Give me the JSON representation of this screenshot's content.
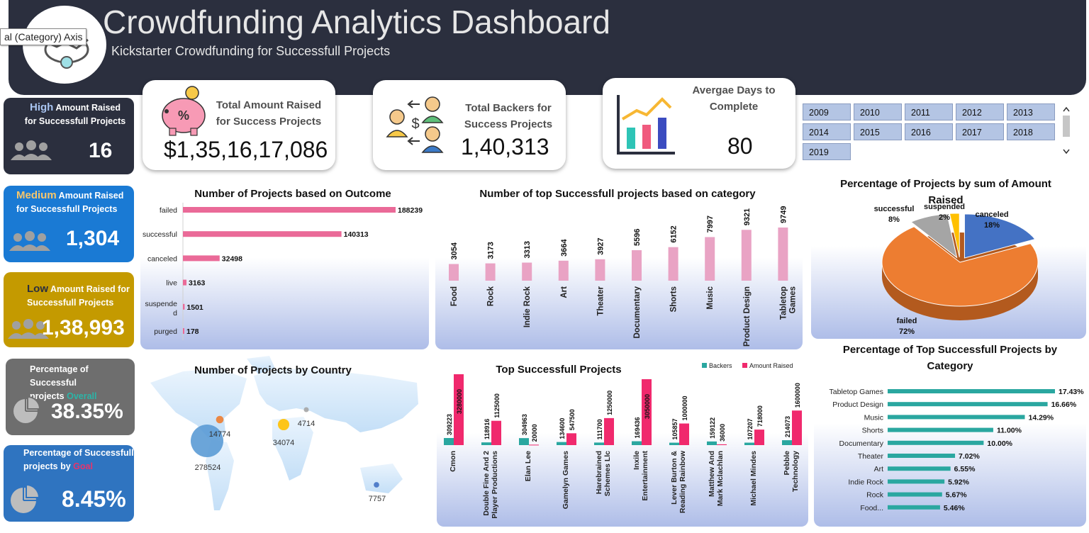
{
  "header": {
    "title": "Crowdfunding Analytics Dashboard",
    "subtitle": "Kickstarter Crowdfunding for Successfull Projects",
    "tooltip": "al (Category) Axis",
    "logo_icon": "handshake-icon"
  },
  "kpis": {
    "amount": {
      "label_line1": "Total Amount Raised",
      "label_line2": "for Success Projects",
      "value": "$1,35,16,17,086",
      "icon": "piggy-bank-icon"
    },
    "backers": {
      "label_line1": "Total Backers for",
      "label_line2": "Success Projects",
      "value": "1,40,313",
      "icon": "people-exchange-icon"
    },
    "days": {
      "label_line1": "Avergae Days to",
      "label_line2": "Complete",
      "value": "80",
      "icon": "bar-chart-icon"
    }
  },
  "years": [
    "2009",
    "2010",
    "2011",
    "2012",
    "2013",
    "2014",
    "2015",
    "2016",
    "2017",
    "2018",
    "2019"
  ],
  "side_cards": [
    {
      "highlight": "High",
      "label_rest": " Amount Raised",
      "label_line2": "for Successfull Projects",
      "value": "16",
      "bg": "#2b2f3e",
      "highlight_color": "#a8c4f0"
    },
    {
      "highlight": "Medium",
      "label_rest": " Amount Raised",
      "label_line2": "for Successfull Projects",
      "value": "1,304",
      "bg": "#1a7ad4",
      "highlight_color": "#f7c66b"
    },
    {
      "highlight": "Low",
      "label_rest": " Amount Raised for",
      "label_line2": "Successfull Projects",
      "value": "1,38,993",
      "bg": "#c49a00",
      "highlight_color": "#2b2f3e"
    },
    {
      "label_line1": "Percentage of Successful",
      "label_line2_prefix": "projects ",
      "highlight": "Overall",
      "value": "38.35%",
      "bg": "#6e6e6e",
      "highlight_color": "#2bb5a8"
    },
    {
      "label_line1": "Percentage of Successfull",
      "label_line2_prefix": "projects by ",
      "highlight": "Goal",
      "value": "8.45%",
      "bg": "#2f74c0",
      "highlight_color": "#e8336b"
    }
  ],
  "chart_data": [
    {
      "type": "bar",
      "orientation": "horizontal",
      "title": "Number of Projects based on Outcome",
      "categories": [
        "failed",
        "successful",
        "canceled",
        "live",
        "suspended",
        "purged"
      ],
      "values": [
        188239,
        140313,
        32498,
        3163,
        1501,
        178
      ],
      "color": "#ea6a98"
    },
    {
      "type": "bar",
      "title": "Number of top Successfull projects based on category",
      "categories": [
        "Food",
        "Rock",
        "Indie Rock",
        "Art",
        "Theater",
        "Documentary",
        "Shorts",
        "Music",
        "Product Design",
        "Tabletop Games"
      ],
      "values": [
        3054,
        3173,
        3313,
        3664,
        3927,
        5596,
        6152,
        7997,
        9321,
        9749
      ],
      "color": "#e9a3c4"
    },
    {
      "type": "pie",
      "title": "Percentage of Projects by sum of Amount Raised",
      "categories": [
        "failed",
        "canceled",
        "successful",
        "suspended"
      ],
      "values": [
        72,
        18,
        8,
        2
      ],
      "labels": [
        "72%",
        "18%",
        "8%",
        "2%"
      ],
      "colors": [
        "#ed7d31",
        "#4472c4",
        "#a5a5a5",
        "#ffc000"
      ]
    },
    {
      "type": "scatter",
      "title": "Number of Projects by Country",
      "labels": [
        "278524",
        "14774",
        "34074",
        "4714",
        "7757"
      ],
      "values": [
        278524,
        14774,
        34074,
        4714,
        7757
      ],
      "colors": [
        "#5b9bd5",
        "#ed7d31",
        "#ffc000",
        "#a5a5a5",
        "#4472c4"
      ]
    },
    {
      "type": "bar",
      "title": "Top Successfull Projects",
      "categories": [
        "Cmon",
        "Double Fine And 2 Player Productions",
        "Elan Lee",
        "Gamelyn Games",
        "Harebrained Schemes Llc",
        "Inxile Entertainment",
        "Lever Burton & Reading Rainbow",
        "Matthew And Mark Mclachlan",
        "Michael Mindes",
        "Pebble Technology"
      ],
      "series": [
        {
          "name": "Backers",
          "values": [
            309223,
            118916,
            304963,
            134600,
            111700,
            169436,
            105857,
            159122,
            107207,
            214073
          ],
          "color": "#2aa7a0"
        },
        {
          "name": "Amount Raised",
          "values": [
            3280000,
            1125000,
            20000,
            547500,
            1250000,
            3050000,
            1000000,
            36000,
            718000,
            1600000
          ],
          "color": "#f0296d"
        }
      ]
    },
    {
      "type": "bar",
      "orientation": "horizontal",
      "title": "Percentage of Top Successfull Projects by Category",
      "categories": [
        "Tabletop Games",
        "Product Design",
        "Music",
        "Shorts",
        "Documentary",
        "Theater",
        "Art",
        "Indie Rock",
        "Rock",
        "Food..."
      ],
      "values": [
        17.43,
        16.66,
        14.29,
        11.0,
        10.0,
        7.02,
        6.55,
        5.92,
        5.67,
        5.46
      ],
      "labels": [
        "17.43%",
        "16.66%",
        "14.29%",
        "11.00%",
        "10.00%",
        "7.02%",
        "6.55%",
        "5.92%",
        "5.67%",
        "5.46%"
      ],
      "color": "#2aa7a0"
    }
  ]
}
